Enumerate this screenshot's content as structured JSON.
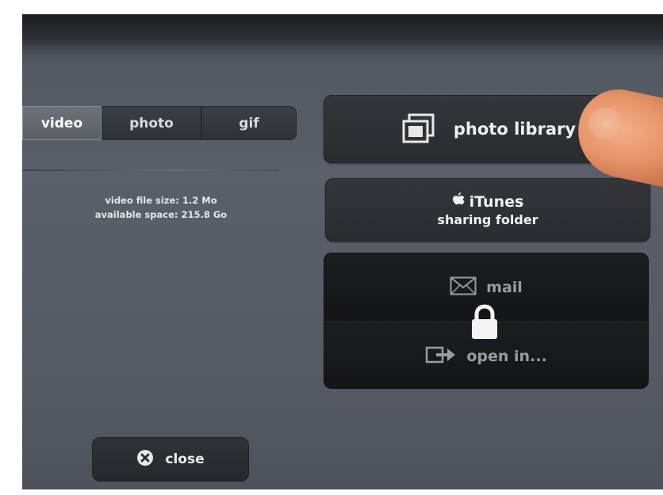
{
  "tabs": [
    {
      "label": "video",
      "active": true
    },
    {
      "label": "photo",
      "active": false
    },
    {
      "label": "gif",
      "active": false
    }
  ],
  "info": {
    "file_size": "video file size: 1.2 Mo",
    "available_space": "available space: 215.8 Go"
  },
  "actions": {
    "photo_library": {
      "label": "photo library",
      "icon": "photo-library-icon"
    },
    "itunes": {
      "line1": "iTunes",
      "line2": "sharing folder",
      "icon": "apple-icon"
    },
    "mail": {
      "label": "mail",
      "icon": "envelope-icon",
      "locked": true
    },
    "open_in": {
      "label": "open in...",
      "icon": "open-in-icon",
      "locked": true
    }
  },
  "close": {
    "label": "close",
    "icon": "close-circle-icon"
  },
  "colors": {
    "background": "#585d66",
    "button": "#2e3035",
    "locked_button": "#18191c",
    "active_tab": "#63676e",
    "text": "#f0f0f0"
  }
}
